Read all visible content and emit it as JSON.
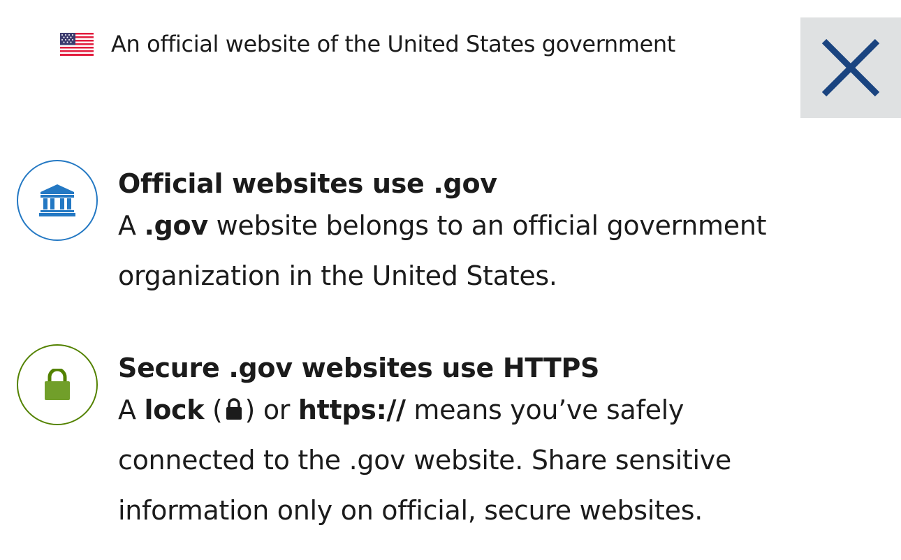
{
  "banner": {
    "official_text": "An official website of the United States government",
    "close_label": "Close"
  },
  "sections": [
    {
      "icon": "bank-icon",
      "color": "#2378c3",
      "title": "Official websites use .gov",
      "line1_pre": "A ",
      "line1_bold": ".gov",
      "line1_post": " website belongs to an official government",
      "line2": "organization in the United States."
    },
    {
      "icon": "lock-icon",
      "color": "#538200",
      "title": "Secure .gov websites use HTTPS",
      "line1_a": "A ",
      "line1_lock": "lock",
      "line1_paren_open": " (",
      "line1_paren_close": ") or ",
      "line1_https": "https://",
      "line1_post": " means you’ve safely",
      "line2": "connected to the .gov website. Share sensitive",
      "line3": "information only on official, secure websites."
    }
  ],
  "colors": {
    "close_bg": "#dfe1e2",
    "close_x": "#1a4480",
    "text": "#1b1b1b"
  }
}
